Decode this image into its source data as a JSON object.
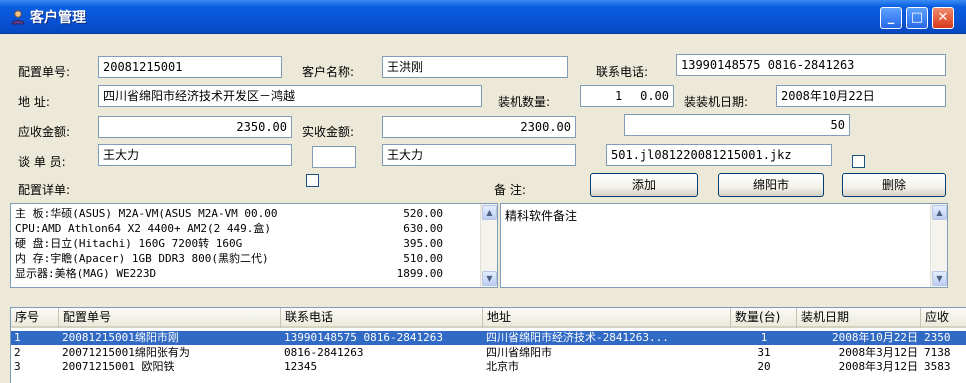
{
  "window": {
    "title": "客户管理"
  },
  "form": {
    "order_no_label": "配置单号:",
    "order_no": "20081215001",
    "customer_name_label": "客户名称:",
    "customer_name": "王洪刚",
    "phone_label": "联系电话:",
    "phone": "13990148575 0816-2841263",
    "address_label": "地    址:",
    "address": "四川省绵阳市经济技术开发区－鸿越",
    "quantity_label": "装机数量:",
    "quantity": "1",
    "qty_right": "0.00",
    "install_date_label": "装装机日期:",
    "install_date": "2008年10月22日",
    "receivable_label": "应收金额:",
    "receivable": "2350.00",
    "received_label": "实收金额:",
    "received": "2300.00",
    "third_value": "50",
    "salesman_label": "谈 单 员:",
    "salesman": "王大力",
    "salesman2": "王大力",
    "file_path": "501.jl081220081215001.jkz",
    "detail_label": "配置详单:",
    "remark_label": "备    注:",
    "remark": "精科软件备注"
  },
  "buttons": {
    "add": "添加",
    "mianyang": "绵阳市",
    "delete": "删除"
  },
  "detail": [
    {
      "text": "主  板:华硕(ASUS) M2A-VM(ASUS M2A-VM 00.00",
      "price": "520.00"
    },
    {
      "text": "CPU:AMD Athlon64 X2 4400+ AM2(2 449.盒)",
      "price": "630.00"
    },
    {
      "text": "硬  盘:日立(Hitachi) 160G 7200转 160G",
      "price": "395.00"
    },
    {
      "text": "内  存:宇瞻(Apacer) 1GB DDR3 800(黑豹二代)",
      "price": "510.00"
    },
    {
      "text": "显示器:美格(MAG) WE223D",
      "price": "1899.00"
    }
  ],
  "table": {
    "headers": [
      "序号",
      "配置单号",
      "联系电话",
      "地址",
      "数量(台)",
      "装机日期",
      "应收"
    ],
    "rows": [
      [
        "1",
        "20081215001绵阳市刚",
        "13990148575 0816-2841263",
        "四川省绵阳市经济技术-2841263...",
        "1",
        "2008年10月22日",
        "2350"
      ],
      [
        "2",
        "20071215001绵阳张有为",
        "0816-2841263",
        "四川省绵阳市",
        "31",
        "2008年3月12日",
        "7138"
      ],
      [
        "3",
        "20071215001   欧阳铁",
        "12345",
        "北京市",
        "20",
        "2008年3月12日",
        "3583"
      ]
    ]
  },
  "colors": {
    "title_bar": "#0a53d6",
    "selection": "#316ac5",
    "window_bg": "#ece9d8"
  }
}
